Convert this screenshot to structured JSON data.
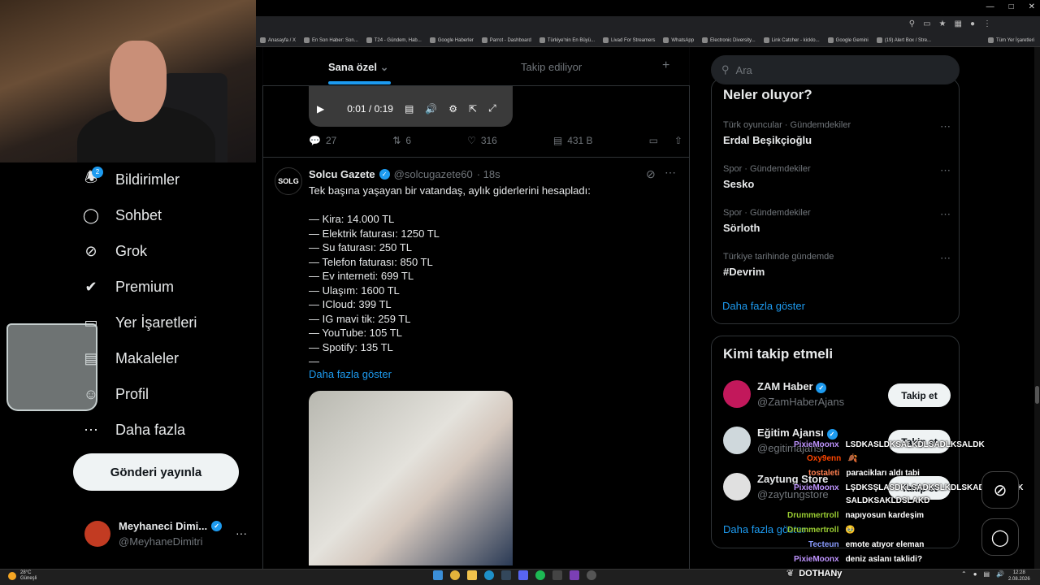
{
  "browser": {
    "bookmarks": [
      "Anasayfa / X",
      "En Son Haber: Son...",
      "T24 - Gündem, Hab...",
      "Google Haberler",
      "Parrot - Dashboard",
      "Türkiye'nin En Büyü...",
      "Livad For Streamers",
      "WhatsApp",
      "Electronic Diversity...",
      "Link Catcher - kicklo...",
      "Google Gemini",
      "(19) Alert Box / Stre...",
      "Tüm Yer İşaretleri"
    ]
  },
  "nav": {
    "notifications": "Bildirimler",
    "notifications_badge": "2",
    "chat": "Sohbet",
    "grok": "Grok",
    "premium": "Premium",
    "bookmarks": "Yer İşaretleri",
    "articles": "Makaleler",
    "profile": "Profil",
    "more": "Daha fazla",
    "post_button": "Gönderi yayınla",
    "user_name": "Meyhaneci Dimi...",
    "user_handle": "@MeyhaneDimitri",
    "user_more": "···"
  },
  "feed": {
    "tab_for_you": "Sana özel",
    "tab_following": "Takip ediliyor",
    "add": "+",
    "video_time": "0:01 / 0:19",
    "reply_count": "27",
    "repost_count": "6",
    "like_count": "316",
    "view_count": "431 B",
    "tweet": {
      "avatar_text": "SOLG",
      "name": "Solcu Gazete",
      "handle": "@solcugazete60",
      "time": "· 18s",
      "lines": [
        "Tek başına yaşayan bir vatandaş, aylık giderlerini hesapladı:",
        "",
        "— Kira: 14.000 TL",
        "— Elektrik faturası: 1250 TL",
        "— Su faturası: 250 TL",
        "— Telefon faturası: 850 TL",
        "— Ev interneti: 699 TL",
        "— Ulaşım: 1600 TL",
        "— ICloud: 399 TL",
        "— IG mavi tik: 259 TL",
        "— YouTube: 105 TL",
        "— Spotify: 135 TL",
        "—"
      ],
      "show_more": "Daha fazla göster"
    }
  },
  "sidebar": {
    "search_placeholder": "Ara",
    "trends_title": "Neler oluyor?",
    "trends": [
      {
        "meta": "Türk oyuncular · Gündemdekiler",
        "name": "Erdal Beşikçioğlu"
      },
      {
        "meta": "Spor · Gündemdekiler",
        "name": "Sesko"
      },
      {
        "meta": "Spor · Gündemdekiler",
        "name": "Sörloth"
      },
      {
        "meta": "Türkiye tarihinde gündemde",
        "name": "#Devrim"
      }
    ],
    "trends_more": "Daha fazla göster",
    "follow_title": "Kimi takip etmeli",
    "who": [
      {
        "name": "ZAM Haber",
        "handle": "@ZamHaberAjans",
        "button": "Takip et",
        "color": "#c2185b"
      },
      {
        "name": "Eğitim Ajansı",
        "handle": "@egitimajansi",
        "button": "Takip et",
        "color": "#cfd8dc"
      },
      {
        "name": "Zaytung Store",
        "handle": "@zaytungstore",
        "button": "Takip et",
        "color": "#e0e0e0"
      }
    ],
    "follow_more": "Daha fazla göster"
  },
  "chat": [
    {
      "user": "PixieMoonx",
      "text": "LSDKASLDKSALKDLSADLKSALDK",
      "color": "#bf94ff"
    },
    {
      "user": "Oxy9enn",
      "text": "🍂",
      "color": "#ff4500"
    },
    {
      "user": "tostaleti",
      "text": "paracikları aldı tabi",
      "color": "#ff7f50"
    },
    {
      "user": "PixieMoonx",
      "text": "LŞDKSŞLASDKLSADKSLKDLSKADLKSALDK",
      "color": "#bf94ff"
    },
    {
      "user": "",
      "text": "SALDKSAKLDSLAKD",
      "color": "#bf94ff"
    },
    {
      "user": "Drummertroll",
      "text": "napıyosun kardeşim",
      "color": "#9acd32"
    },
    {
      "user": "Drummertroll",
      "text": "🥹",
      "color": "#9acd32"
    },
    {
      "user": "Tecteun",
      "text": "emote atıyor eleman",
      "color": "#8a9cff"
    },
    {
      "user": "PixieMoonx",
      "text": "deniz aslanı taklidi?",
      "color": "#bf94ff"
    }
  ],
  "stream": {
    "streamer": "DOTHANy"
  },
  "taskbar": {
    "weather_temp": "28°C",
    "weather_desc": "Güneşli",
    "time": "12:28",
    "date": "2.08.2026"
  }
}
